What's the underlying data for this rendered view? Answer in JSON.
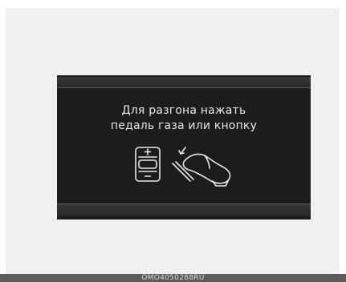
{
  "display": {
    "message_line1": "Для разгона нажать",
    "message_line2": "педаль газа или кнопку"
  },
  "icons": [
    "cruise-switch-icon",
    "accelerator-pedal-icon"
  ],
  "caption": "OMO4050288RU",
  "colors": {
    "screen_background": "#1c1c1c",
    "text": "#e6e6e6",
    "page_background": "#f0f0f0",
    "caption_bar": "#5c5c5c"
  }
}
